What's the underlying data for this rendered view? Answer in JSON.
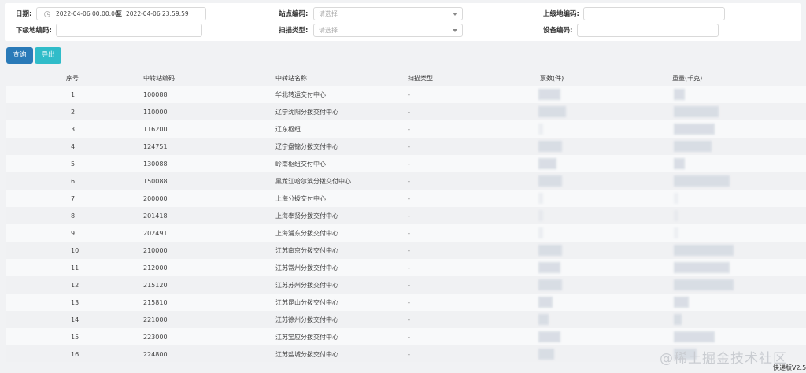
{
  "filters": {
    "date_label": "日期:",
    "date_start": "2022-04-06 00:00:00",
    "date_sep": "至",
    "date_end": "2022-04-06 23:59:59",
    "station_code_label": "站点编码:",
    "station_code_placeholder": "请选择",
    "upper_code_label": "上级地编码:",
    "upper_code_value": "",
    "lower_code_label": "下级地编码:",
    "lower_code_value": "",
    "scan_type_label": "扫描类型:",
    "scan_type_placeholder": "请选择",
    "device_code_label": "设备编码:",
    "device_code_value": ""
  },
  "actions": {
    "query_label": "查询",
    "export_label": "导出"
  },
  "table": {
    "headers": [
      "序号",
      "中转站编码",
      "中转站名称",
      "扫描类型",
      "票数(件)",
      "重量(千克)"
    ],
    "rows": [
      {
        "index": "1",
        "code": "100088",
        "name": "华北转运交付中心",
        "scan_type": "-",
        "tickets_level": 0.55,
        "weight_level": 0.15
      },
      {
        "index": "2",
        "code": "110000",
        "name": "辽宁沈阳分拨交付中心",
        "scan_type": "-",
        "tickets_level": 0.7,
        "weight_level": 0.6
      },
      {
        "index": "3",
        "code": "116200",
        "name": "辽东枢纽",
        "scan_type": "-",
        "tickets_level": 0.0,
        "weight_level": 0.55
      },
      {
        "index": "4",
        "code": "124751",
        "name": "辽宁盘锦分拨交付中心",
        "scan_type": "-",
        "tickets_level": 0.6,
        "weight_level": 0.5
      },
      {
        "index": "5",
        "code": "130088",
        "name": "岭南枢纽交付中心",
        "scan_type": "-",
        "tickets_level": 0.45,
        "weight_level": 0.15
      },
      {
        "index": "6",
        "code": "150088",
        "name": "黑龙江哈尔滨分拨交付中心",
        "scan_type": "-",
        "tickets_level": 0.6,
        "weight_level": 0.75
      },
      {
        "index": "7",
        "code": "200000",
        "name": "上海分拨交付中心",
        "scan_type": "-",
        "tickets_level": 0.0,
        "weight_level": 0.0
      },
      {
        "index": "8",
        "code": "201418",
        "name": "上海奉贤分拨交付中心",
        "scan_type": "-",
        "tickets_level": 0.0,
        "weight_level": 0.0
      },
      {
        "index": "9",
        "code": "202491",
        "name": "上海浦东分拨交付中心",
        "scan_type": "-",
        "tickets_level": 0.0,
        "weight_level": 0.0
      },
      {
        "index": "10",
        "code": "210000",
        "name": "江苏南京分拨交付中心",
        "scan_type": "-",
        "tickets_level": 0.6,
        "weight_level": 0.8
      },
      {
        "index": "11",
        "code": "212000",
        "name": "江苏常州分拨交付中心",
        "scan_type": "-",
        "tickets_level": 0.55,
        "weight_level": 0.75
      },
      {
        "index": "12",
        "code": "215120",
        "name": "江苏苏州分拨交付中心",
        "scan_type": "-",
        "tickets_level": 0.6,
        "weight_level": 0.8
      },
      {
        "index": "13",
        "code": "215810",
        "name": "江苏昆山分拨交付中心",
        "scan_type": "-",
        "tickets_level": 0.35,
        "weight_level": 0.2
      },
      {
        "index": "14",
        "code": "221000",
        "name": "江苏徐州分拨交付中心",
        "scan_type": "-",
        "tickets_level": 0.25,
        "weight_level": 0.1
      },
      {
        "index": "15",
        "code": "223000",
        "name": "江苏宝应分拨交付中心",
        "scan_type": "-",
        "tickets_level": 0.55,
        "weight_level": 0.55
      },
      {
        "index": "16",
        "code": "224800",
        "name": "江苏盐城分拨交付中心",
        "scan_type": "-",
        "tickets_level": 0.4,
        "weight_level": 0.3
      }
    ]
  },
  "watermark": "@稀土掘金技术社区",
  "footer": {
    "version": "快递版V2.5"
  },
  "colors": {
    "query_button": "#2a7ab8",
    "export_button": "#30bcc9",
    "row_odd": "#f8f9fa",
    "row_even": "#f0f1f3"
  }
}
